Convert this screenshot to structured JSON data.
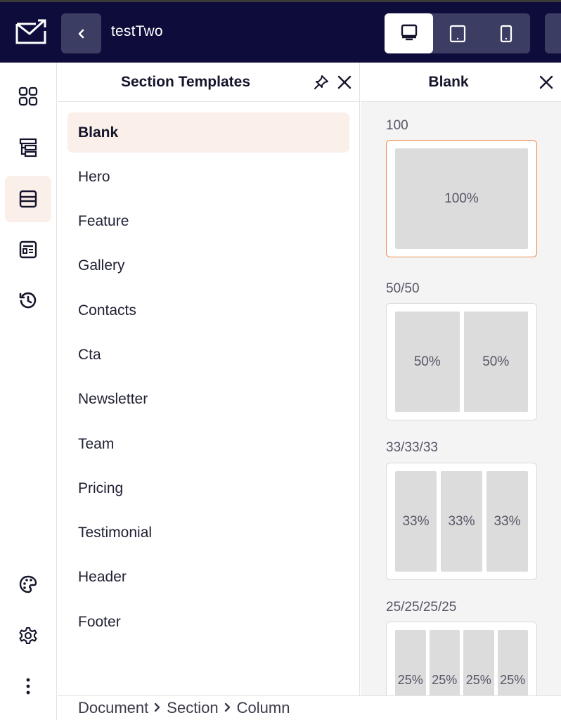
{
  "app": {
    "title": "testTwo"
  },
  "devices": [
    {
      "name": "desktop",
      "active": true
    },
    {
      "name": "tablet",
      "active": false
    },
    {
      "name": "mobile",
      "active": false
    }
  ],
  "rail": {
    "items": [
      {
        "icon": "blocks-grid-icon",
        "active": false
      },
      {
        "icon": "layers-tree-icon",
        "active": false
      },
      {
        "icon": "sections-icon",
        "active": true
      },
      {
        "icon": "templates-icon",
        "active": false
      },
      {
        "icon": "history-icon",
        "active": false
      },
      {
        "icon": "palette-icon",
        "active": false
      },
      {
        "icon": "settings-icon",
        "active": false
      },
      {
        "icon": "more-vertical-icon",
        "active": false
      }
    ]
  },
  "section_templates": {
    "title": "Section Templates",
    "categories": [
      "Blank",
      "Hero",
      "Feature",
      "Gallery",
      "Contacts",
      "Cta",
      "Newsletter",
      "Team",
      "Pricing",
      "Testimonial",
      "Header",
      "Footer"
    ],
    "selected": "Blank"
  },
  "preview": {
    "title": "Blank",
    "layouts": [
      {
        "label": "100",
        "columns": [
          "100%"
        ],
        "selected": true
      },
      {
        "label": "50/50",
        "columns": [
          "50%",
          "50%"
        ],
        "selected": false
      },
      {
        "label": "33/33/33",
        "columns": [
          "33%",
          "33%",
          "33%"
        ],
        "selected": false
      },
      {
        "label": "25/25/25/25",
        "columns": [
          "25%",
          "25%",
          "25%",
          "25%"
        ],
        "selected": false
      }
    ]
  },
  "breadcrumb": [
    "Document",
    "Section",
    "Column"
  ],
  "colors": {
    "topbar_bg": "#0d0c3b",
    "accent_highlight": "#fbefe9",
    "selected_border": "#ec8a4c"
  }
}
